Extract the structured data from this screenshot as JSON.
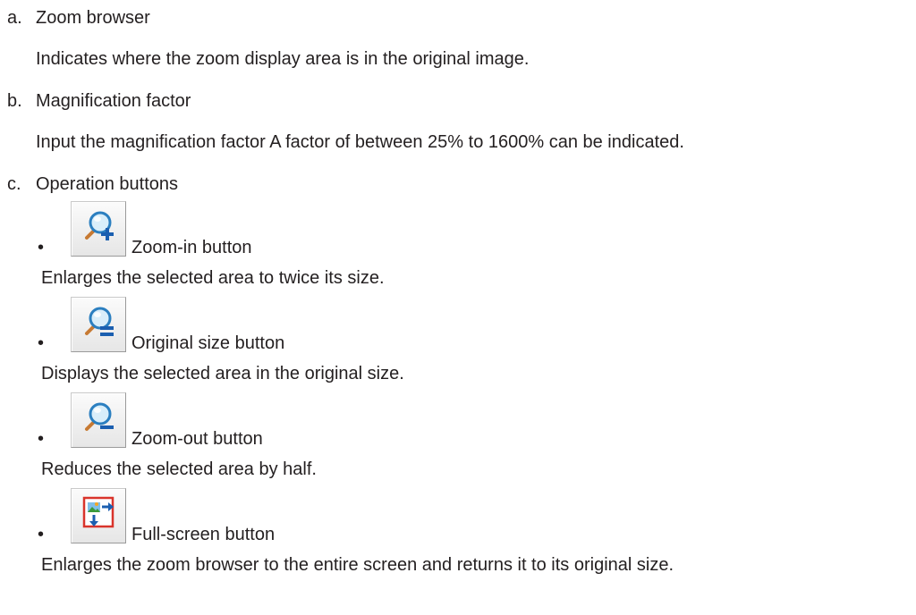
{
  "items": [
    {
      "marker": "a.",
      "title": "Zoom browser",
      "description": "Indicates where the zoom display area is in the original image."
    },
    {
      "marker": "b.",
      "title": "Magnification factor",
      "description": "Input the magnification factor A factor of between 25% to 1600% can be indicated."
    },
    {
      "marker": "c.",
      "title": "Operation buttons"
    }
  ],
  "buttons": [
    {
      "bullet": "•",
      "icon": "zoom-in-icon",
      "title": "Zoom-in button",
      "description": "Enlarges the selected area to twice its size."
    },
    {
      "bullet": "•",
      "icon": "original-size-icon",
      "title": "Original size button",
      "description": "Displays the selected area in the original size."
    },
    {
      "bullet": "•",
      "icon": "zoom-out-icon",
      "title": "Zoom-out button",
      "description": "Reduces the selected area by half."
    },
    {
      "bullet": "•",
      "icon": "full-screen-icon",
      "title": "Full-screen button",
      "description": "Enlarges the zoom browser to the entire screen and returns it to its original size."
    }
  ]
}
